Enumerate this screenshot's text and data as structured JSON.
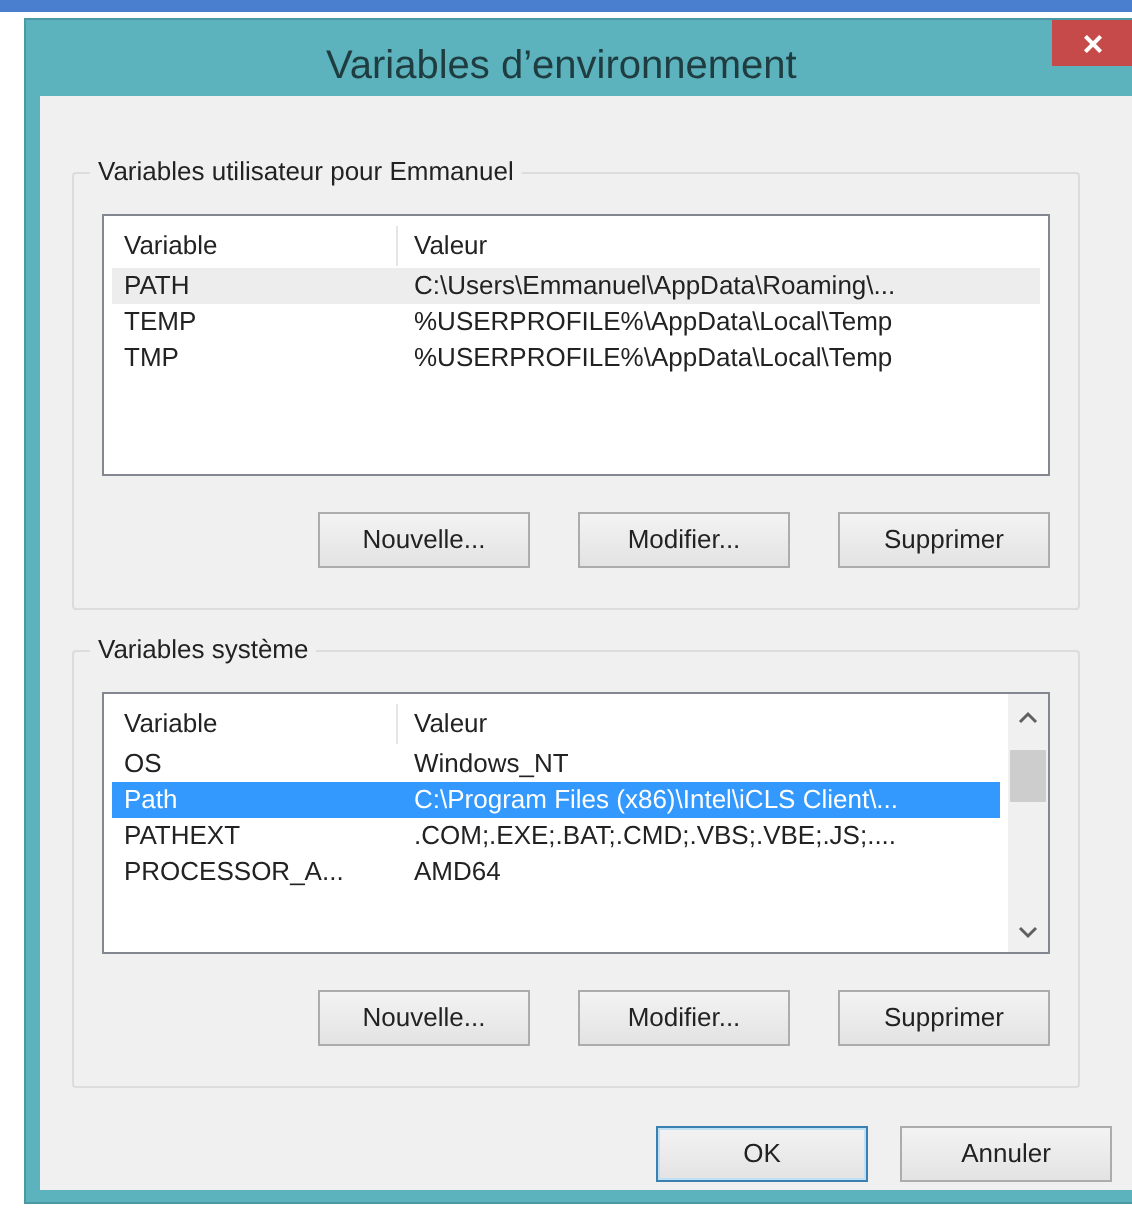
{
  "window": {
    "title": "Variables d’environnement",
    "close": "×"
  },
  "groups": [
    {
      "label": "Variables utilisateur pour Emmanuel",
      "columns": [
        "Variable",
        "Valeur"
      ],
      "scrollbar": false,
      "rows": [
        {
          "name": "PATH",
          "value": "C:\\Users\\Emmanuel\\AppData\\Roaming\\...",
          "selected": false,
          "hovered": true
        },
        {
          "name": "TEMP",
          "value": "%USERPROFILE%\\AppData\\Local\\Temp",
          "selected": false,
          "hovered": false
        },
        {
          "name": "TMP",
          "value": "%USERPROFILE%\\AppData\\Local\\Temp",
          "selected": false,
          "hovered": false
        }
      ],
      "buttons": [
        "Nouvelle...",
        "Modifier...",
        "Supprimer"
      ]
    },
    {
      "label": "Variables système",
      "columns": [
        "Variable",
        "Valeur"
      ],
      "scrollbar": true,
      "rows": [
        {
          "name": "OS",
          "value": "Windows_NT",
          "selected": false,
          "hovered": false
        },
        {
          "name": "Path",
          "value": "C:\\Program Files (x86)\\Intel\\iCLS Client\\...",
          "selected": true,
          "hovered": false
        },
        {
          "name": "PATHEXT",
          "value": ".COM;.EXE;.BAT;.CMD;.VBS;.VBE;.JS;....",
          "selected": false,
          "hovered": false
        },
        {
          "name": "PROCESSOR_A...",
          "value": "AMD64",
          "selected": false,
          "hovered": false
        }
      ],
      "buttons": [
        "Nouvelle...",
        "Modifier...",
        "Supprimer"
      ]
    }
  ],
  "footer_buttons": [
    {
      "label": "OK",
      "default": true
    },
    {
      "label": "Annuler",
      "default": false
    }
  ]
}
